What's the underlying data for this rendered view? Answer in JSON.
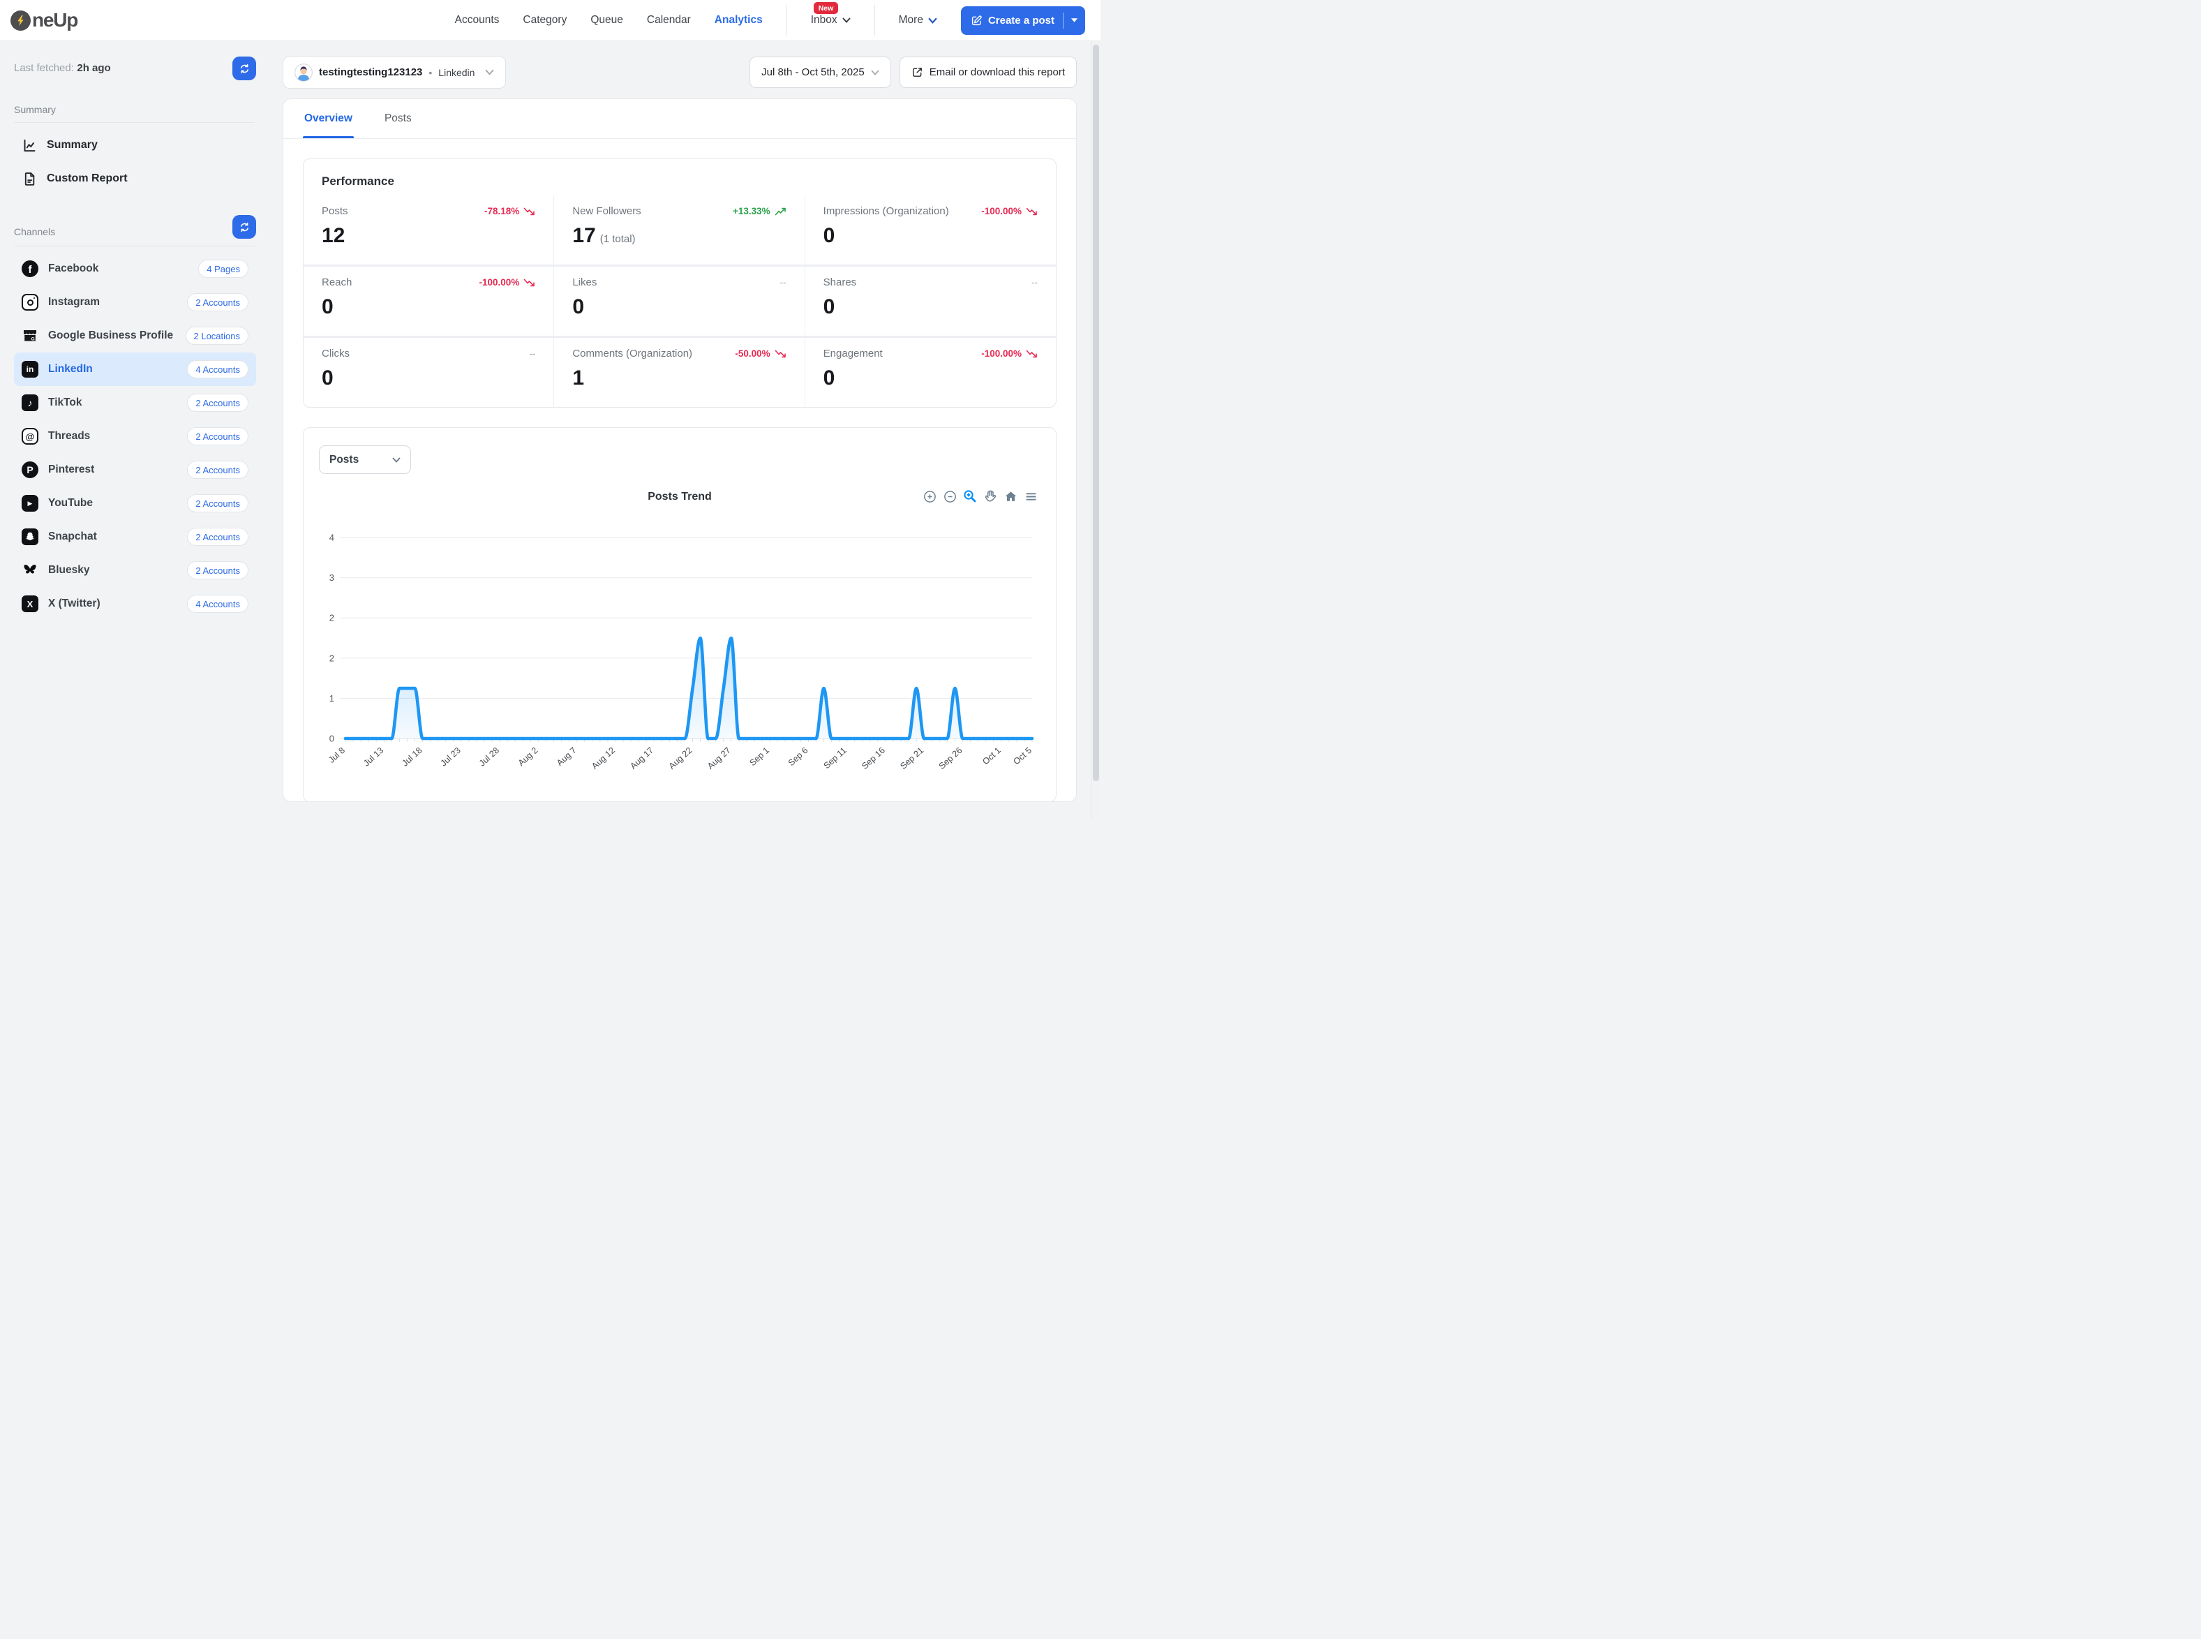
{
  "colors": {
    "accent_blue": "#2e6be8",
    "active_item_bg": "#dbeafd",
    "negative_red": "#e62b54",
    "positive_green": "#2aa24b",
    "chart_line_blue": "#1e97f4",
    "toolbar_active_blue": "#008ffb",
    "badge_red": "#e12b3d"
  },
  "header": {
    "logo_text": "neUp",
    "nav": [
      {
        "label": "Accounts"
      },
      {
        "label": "Category"
      },
      {
        "label": "Queue"
      },
      {
        "label": "Calendar"
      },
      {
        "label": "Analytics",
        "active": true
      },
      {
        "label": "Inbox",
        "badge": "New",
        "chevron": true
      },
      {
        "label": "More",
        "chevron": true
      }
    ],
    "inbox_badge": "New",
    "create_post_label": "Create a post"
  },
  "sidebar": {
    "last_fetched_label": "Last fetched:",
    "last_fetched_value": "2h ago",
    "summary_section_label": "Summary",
    "summary_items": [
      {
        "label": "Summary",
        "icon": "line-chart-icon"
      },
      {
        "label": "Custom Report",
        "icon": "document-icon"
      }
    ],
    "channels_section_label": "Channels",
    "channels": [
      {
        "name": "Facebook",
        "badge": "4 Pages",
        "icon": "facebook-icon"
      },
      {
        "name": "Instagram",
        "badge": "2 Accounts",
        "icon": "instagram-icon"
      },
      {
        "name": "Google Business Profile",
        "badge": "2 Locations",
        "icon": "google-business-icon"
      },
      {
        "name": "LinkedIn",
        "badge": "4 Accounts",
        "icon": "linkedin-icon",
        "active": true
      },
      {
        "name": "TikTok",
        "badge": "2 Accounts",
        "icon": "tiktok-icon"
      },
      {
        "name": "Threads",
        "badge": "2 Accounts",
        "icon": "threads-icon"
      },
      {
        "name": "Pinterest",
        "badge": "2 Accounts",
        "icon": "pinterest-icon"
      },
      {
        "name": "YouTube",
        "badge": "2 Accounts",
        "icon": "youtube-icon"
      },
      {
        "name": "Snapchat",
        "badge": "2 Accounts",
        "icon": "snapchat-icon"
      },
      {
        "name": "Bluesky",
        "badge": "2 Accounts",
        "icon": "bluesky-icon"
      },
      {
        "name": "X (Twitter)",
        "badge": "4 Accounts",
        "icon": "x-twitter-icon"
      }
    ]
  },
  "toolbar": {
    "account_name": "testingtesting123123",
    "separator": "•",
    "account_network": "Linkedin",
    "date_range": "Jul 8th - Oct 5th, 2025",
    "export_label": "Email or download this report"
  },
  "tabs": [
    {
      "label": "Overview",
      "active": true
    },
    {
      "label": "Posts"
    }
  ],
  "performance": {
    "title": "Performance",
    "metrics": [
      {
        "label": "Posts",
        "value": "12",
        "delta": "-78.18%",
        "trend": "down"
      },
      {
        "label": "New Followers",
        "value": "17",
        "suffix": "(1 total)",
        "delta": "+13.33%",
        "trend": "up"
      },
      {
        "label": "Impressions (Organization)",
        "value": "0",
        "delta": "-100.00%",
        "trend": "down"
      },
      {
        "label": "Reach",
        "value": "0",
        "delta": "-100.00%",
        "trend": "down"
      },
      {
        "label": "Likes",
        "value": "0",
        "delta": "--",
        "trend": "none"
      },
      {
        "label": "Shares",
        "value": "0",
        "delta": "--",
        "trend": "none"
      },
      {
        "label": "Clicks",
        "value": "0",
        "delta": "--",
        "trend": "none"
      },
      {
        "label": "Comments (Organization)",
        "value": "1",
        "delta": "-50.00%",
        "trend": "down"
      },
      {
        "label": "Engagement",
        "value": "0",
        "delta": "-100.00%",
        "trend": "down"
      }
    ]
  },
  "chart_section": {
    "selector_value": "Posts",
    "toolbar_icons": [
      "zoom-in-icon",
      "zoom-out-icon",
      "selection-zoom-icon",
      "pan-icon",
      "home-icon",
      "menu-icon"
    ],
    "toolbar_active_icon": "selection-zoom-icon"
  },
  "chart_data": {
    "type": "area",
    "title": "Posts Trend",
    "series_name": "Posts",
    "x_start": "Jul 8",
    "x_end": "Oct 5",
    "tick_days": [
      0,
      5,
      10,
      15,
      20,
      25,
      30,
      35,
      40,
      45,
      50,
      55,
      60,
      65,
      70,
      75,
      80,
      85,
      89
    ],
    "tick_labels": [
      "Jul 8",
      "Jul 13",
      "Jul 18",
      "Jul 23",
      "Jul 28",
      "Aug 2",
      "Aug 7",
      "Aug 12",
      "Aug 17",
      "Aug 22",
      "Aug 27",
      "Sep 1",
      "Sep 6",
      "Sep 11",
      "Sep 16",
      "Sep 21",
      "Sep 26",
      "Oct 1",
      "Oct 5"
    ],
    "y_ticks": [
      {
        "v": 0,
        "label": "0"
      },
      {
        "v": 0.8,
        "label": "1"
      },
      {
        "v": 1.6,
        "label": "2"
      },
      {
        "v": 2.4,
        "label": "2"
      },
      {
        "v": 3.2,
        "label": "3"
      },
      {
        "v": 4,
        "label": "4"
      }
    ],
    "ylim": [
      0,
      4
    ],
    "grid": true,
    "values": [
      0,
      0,
      0,
      0,
      0,
      0,
      0,
      1,
      1,
      1,
      0,
      0,
      0,
      0,
      0,
      0,
      0,
      0,
      0,
      0,
      0,
      0,
      0,
      0,
      0,
      0,
      0,
      0,
      0,
      0,
      0,
      0,
      0,
      0,
      0,
      0,
      0,
      0,
      0,
      0,
      0,
      0,
      0,
      0,
      0,
      1,
      2,
      0,
      0,
      1,
      2,
      0,
      0,
      0,
      0,
      0,
      0,
      0,
      0,
      0,
      0,
      0,
      1,
      0,
      0,
      0,
      0,
      0,
      0,
      0,
      0,
      0,
      0,
      0,
      1,
      0,
      0,
      0,
      0,
      1,
      0,
      0,
      0,
      0,
      0,
      0,
      0,
      0,
      0,
      0
    ]
  }
}
